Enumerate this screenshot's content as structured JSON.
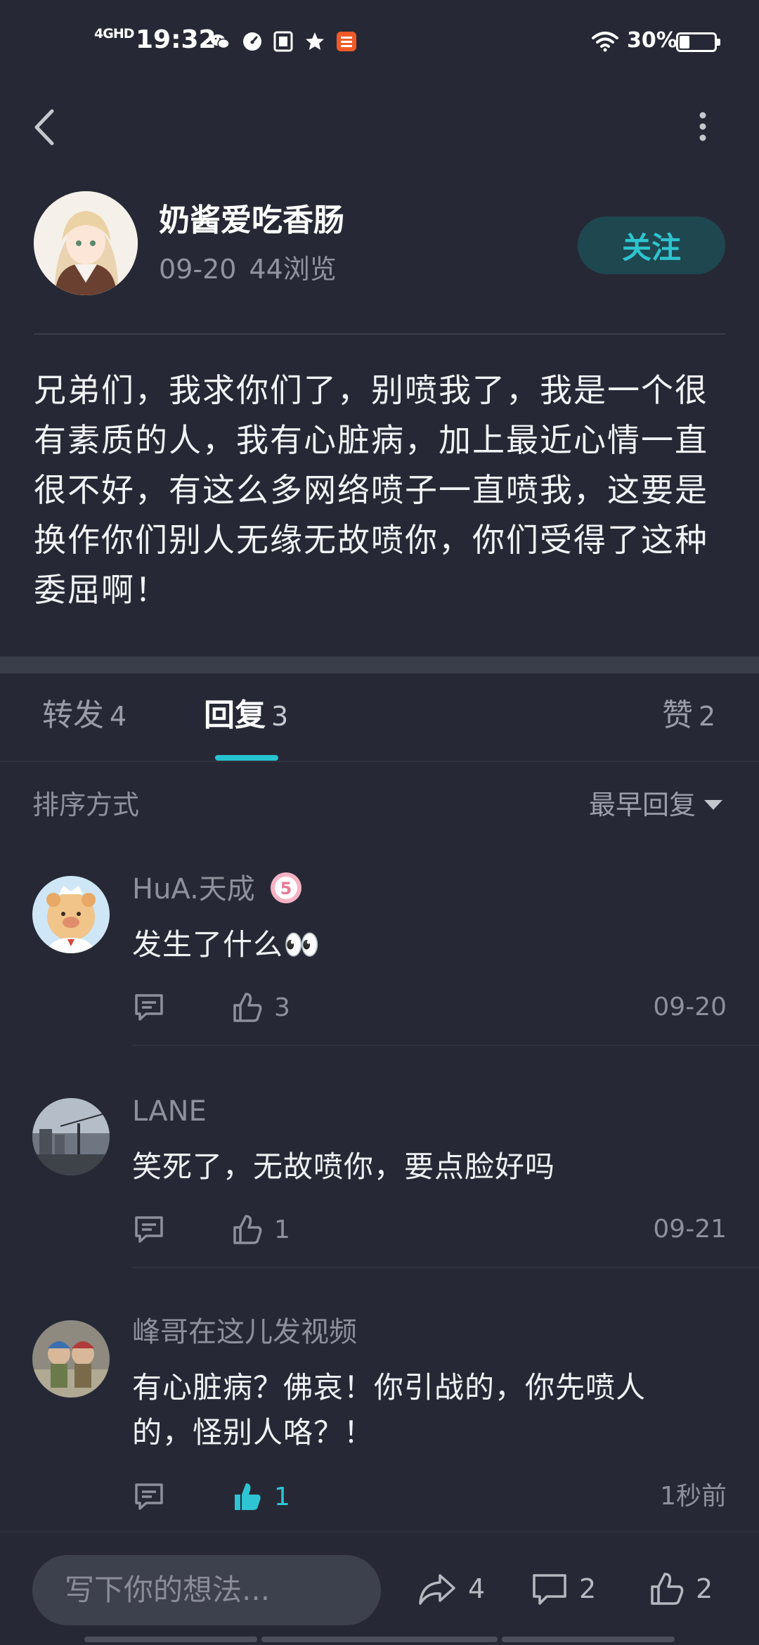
{
  "status_bar": {
    "network": "4GHD",
    "time": "19:32",
    "battery": "30%",
    "battery_level": 0.3,
    "icons": [
      "wechat-icon",
      "speedometer-icon",
      "document-icon",
      "star-icon",
      "bank-app-icon",
      "wifi-icon",
      "battery-icon"
    ]
  },
  "header": {
    "back_icon": "chevron-left-icon",
    "more_icon": "more-vertical-icon"
  },
  "post": {
    "author": "奶酱爱吃香肠",
    "date": "09-20",
    "views": "44浏览",
    "follow_label": "关注",
    "body": "兄弟们，我求你们了，别喷我了，我是一个很有素质的人，我有心脏病，加上最近心情一直很不好，有这么多网络喷子一直喷我，这要是换作你们别人无缘无故喷你，你们受得了这种委屈啊！"
  },
  "tabs": {
    "repost": {
      "label": "转发",
      "count": "4"
    },
    "reply": {
      "label": "回复",
      "count": "3",
      "active": true
    },
    "like": {
      "label": "赞",
      "count": "2"
    }
  },
  "sort": {
    "label": "排序方式",
    "selected": "最早回复"
  },
  "comments": [
    {
      "name": "HuA.天成",
      "badge": "5",
      "text": "发生了什么👀",
      "likes": "3",
      "liked": false,
      "time": "09-20"
    },
    {
      "name": "LANE",
      "text": "笑死了，无故喷你，要点脸好吗",
      "likes": "1",
      "liked": false,
      "time": "09-21"
    },
    {
      "name": "峰哥在这儿发视频",
      "text": "有心脏病？佛哀！你引战的，你先喷人的，怪别人咯？！",
      "likes": "1",
      "liked": true,
      "time": "1秒前"
    }
  ],
  "bottom_bar": {
    "input_placeholder": "写下你的想法...",
    "repost_count": "4",
    "comment_count": "2",
    "like_count": "2"
  },
  "colors": {
    "background": "#262935",
    "accent": "#27c3d0",
    "follow_bg": "#1f4750",
    "muted_text": "#8e919c"
  }
}
